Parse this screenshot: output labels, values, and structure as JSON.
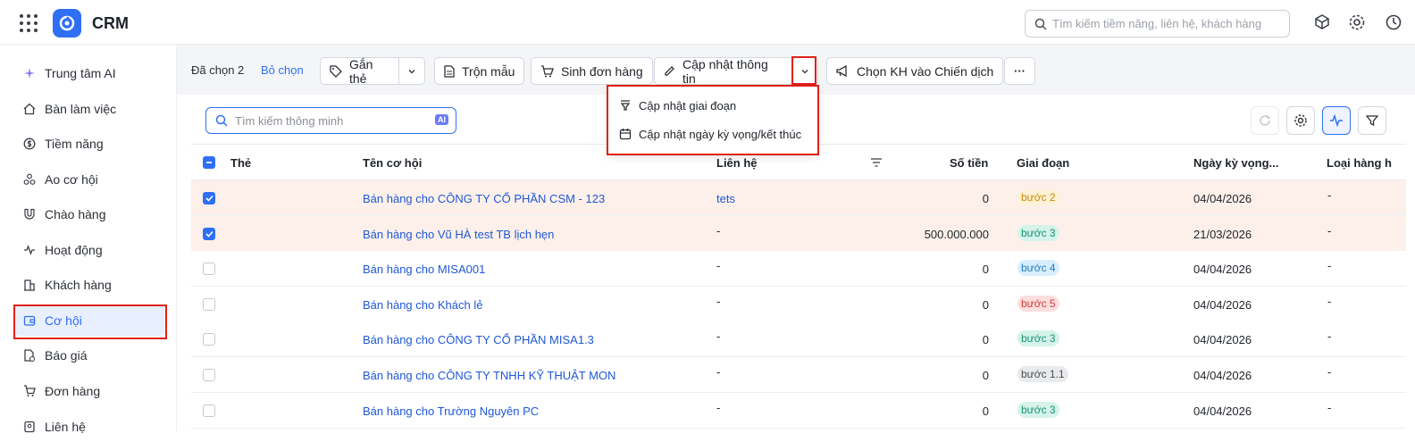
{
  "app": {
    "title": "CRM"
  },
  "search": {
    "placeholder": "Tìm kiếm tiềm năng, liên hệ, khách hàng"
  },
  "sidebar": {
    "items": [
      {
        "label": "Trung tâm AI",
        "icon": "sparkle-icon"
      },
      {
        "label": "Bàn làm việc",
        "icon": "home-icon"
      },
      {
        "label": "Tiềm năng",
        "icon": "dollar-circle-icon"
      },
      {
        "label": "Ao cơ hội",
        "icon": "nodes-icon"
      },
      {
        "label": "Chào hàng",
        "icon": "magnet-icon"
      },
      {
        "label": "Hoạt động",
        "icon": "pulse-icon"
      },
      {
        "label": "Khách hàng",
        "icon": "building-icon"
      },
      {
        "label": "Cơ hội",
        "icon": "wallet-icon"
      },
      {
        "label": "Báo giá",
        "icon": "document-dollar-icon"
      },
      {
        "label": "Đơn hàng",
        "icon": "cart-icon"
      },
      {
        "label": "Liên hệ",
        "icon": "contact-icon"
      }
    ]
  },
  "toolbar": {
    "selected_text": "Đã chọn 2",
    "clear_label": "Bỏ chọn",
    "tag_label": "Gắn thẻ",
    "merge_label": "Trộn mẫu",
    "order_label": "Sinh đơn hàng",
    "update_label": "Cập nhật thông tin",
    "campaign_label": "Chọn KH vào Chiến dịch",
    "more_label": "···"
  },
  "dropdown": {
    "items": [
      "Cập nhật giai đoạn",
      "Cập nhật ngày kỳ vọng/kết thúc"
    ]
  },
  "content": {
    "smart_search_placeholder": "Tìm kiếm thông minh",
    "ai_label": "AI"
  },
  "table": {
    "headers": {
      "tag": "Thẻ",
      "name": "Tên cơ hội",
      "contact": "Liên hệ",
      "amount": "Số tiền",
      "stage": "Giai đoạn",
      "expected_date": "Ngày kỳ vọng...",
      "product_type": "Loại hàng h"
    },
    "rows": [
      {
        "checked": true,
        "name": "Bán hàng cho CÔNG TY CỔ PHẦN CSM - 123",
        "contact": "tets",
        "amount": "0",
        "stage": "bước 2",
        "stage_bg": "#fdf2d6",
        "stage_fg": "#c98a0a",
        "date": "04/04/2026",
        "type": "-"
      },
      {
        "checked": true,
        "name": "Bán hàng cho Vũ HÀ test TB lịch hẹn",
        "contact": "-",
        "amount": "500.000.000",
        "stage": "bước 3",
        "stage_bg": "#d5f3ea",
        "stage_fg": "#17946e",
        "date": "21/03/2026",
        "type": "-"
      },
      {
        "checked": false,
        "name": "Bán hàng cho MISA001",
        "contact": "-",
        "amount": "0",
        "stage": "bước 4",
        "stage_bg": "#d9eefc",
        "stage_fg": "#1b7fc4",
        "date": "04/04/2026",
        "type": "-"
      },
      {
        "checked": false,
        "name": "Bán hàng cho Khách lẻ",
        "contact": "-",
        "amount": "0",
        "stage": "bước 5",
        "stage_bg": "#fbdede",
        "stage_fg": "#d23a3a",
        "date": "04/04/2026",
        "type": "-"
      },
      {
        "checked": false,
        "name": "Bán hàng cho CÔNG TY CỔ PHẦN MISA1.3",
        "contact": "-",
        "amount": "0",
        "stage": "bước 3",
        "stage_bg": "#d5f3ea",
        "stage_fg": "#17946e",
        "date": "04/04/2026",
        "type": "-"
      },
      {
        "checked": false,
        "name": "Bán hàng cho CÔNG TY TNHH KỸ THUẬT MON",
        "contact": "-",
        "amount": "0",
        "stage": "bước 1.1",
        "stage_bg": "#e9eaec",
        "stage_fg": "#4a4f57",
        "date": "04/04/2026",
        "type": "-"
      },
      {
        "checked": false,
        "name": "Bán hàng cho Trường Nguyên PC",
        "contact": "-",
        "amount": "0",
        "stage": "bước 3",
        "stage_bg": "#d5f3ea",
        "stage_fg": "#17946e",
        "date": "04/04/2026",
        "type": "-"
      }
    ]
  },
  "colors": {
    "accent": "#2e6ff6",
    "highlight": "#e0201a",
    "selected_row": "#fdf0ea"
  }
}
